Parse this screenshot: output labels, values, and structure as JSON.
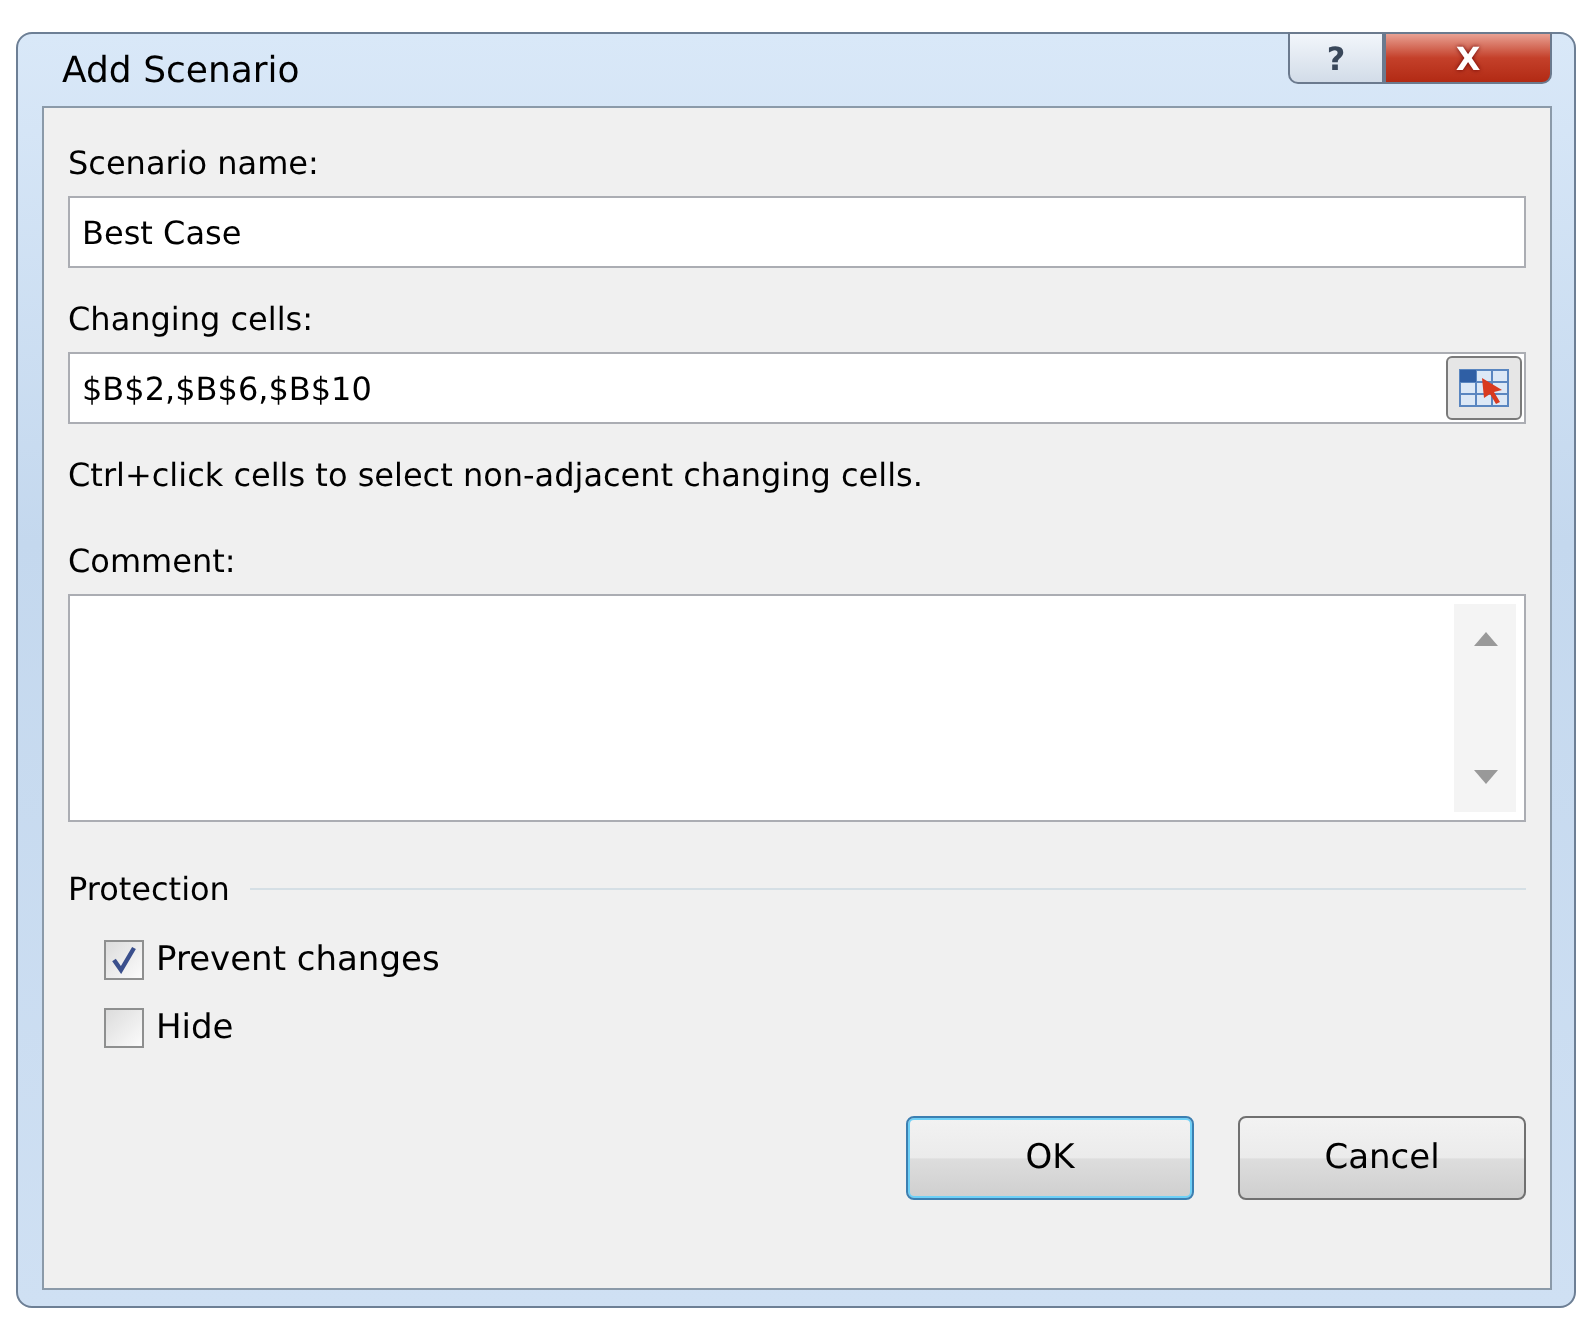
{
  "window": {
    "title": "Add Scenario",
    "buttons": [
      {
        "kind": "help",
        "label": "?"
      },
      {
        "kind": "close",
        "label": "X"
      }
    ]
  },
  "scenario_name": {
    "label": "Scenario name:",
    "value": "Best Case"
  },
  "changing_cells": {
    "label": "Changing cells:",
    "value": "$B$2,$B$6,$B$10",
    "hint": "Ctrl+click cells to select non-adjacent changing cells."
  },
  "comment": {
    "label": "Comment:"
  },
  "protection": {
    "title": "Protection",
    "options": [
      {
        "label": "Prevent changes",
        "checked": true
      },
      {
        "label": "Hide",
        "checked": false
      }
    ]
  },
  "buttons": [
    {
      "label": "OK",
      "default": true
    },
    {
      "label": "Cancel",
      "default": false
    }
  ]
}
